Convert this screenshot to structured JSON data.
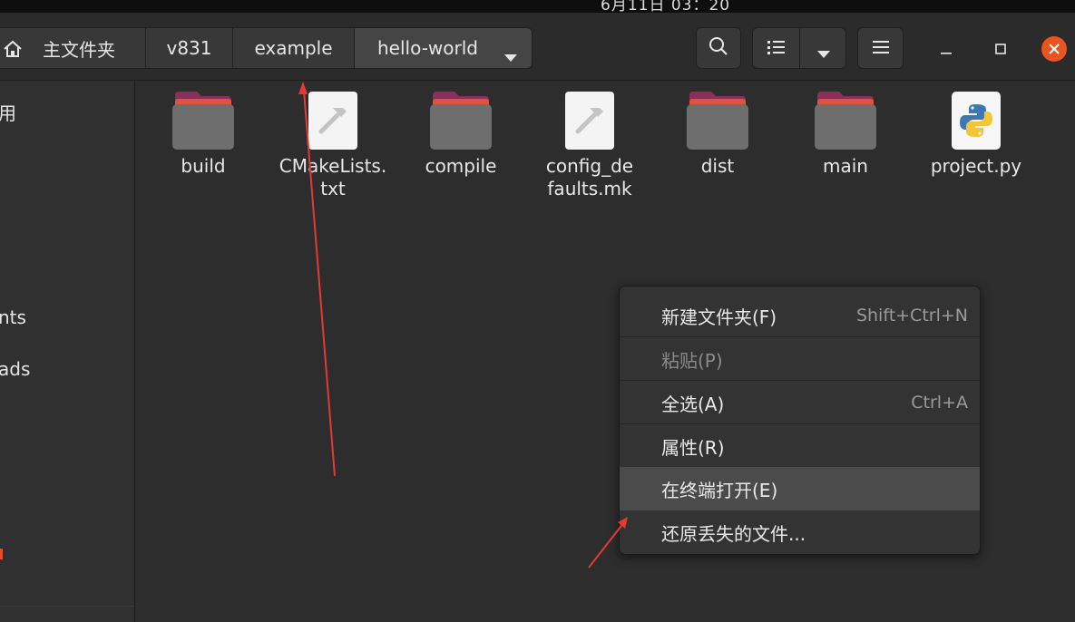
{
  "topbar": {
    "clock": "6月11日  03：20"
  },
  "header": {
    "home_icon": "home-icon",
    "breadcrumbs": [
      {
        "label": "主文件夹"
      },
      {
        "label": "v831"
      },
      {
        "label": "example"
      },
      {
        "label": "hello-world"
      }
    ],
    "crumb_menu_icon": "chevron-down-icon",
    "search_icon": "search-icon",
    "view_icon": "list-view-icon",
    "view_menu_icon": "chevron-down-icon",
    "menu_icon": "hamburger-icon",
    "window": {
      "minimize": "–",
      "maximize": "□",
      "close": "✕"
    },
    "accent_close": "#e95420"
  },
  "sidebar": {
    "items": [
      {
        "label": "用"
      },
      {
        "label": "nts"
      },
      {
        "label": "ads"
      }
    ]
  },
  "files": [
    {
      "name": "build",
      "kind": "folder"
    },
    {
      "name": "CMakeLists.txt",
      "kind": "text"
    },
    {
      "name": "compile",
      "kind": "folder"
    },
    {
      "name": "config_defaults.mk",
      "kind": "text"
    },
    {
      "name": "dist",
      "kind": "folder"
    },
    {
      "name": "main",
      "kind": "folder"
    },
    {
      "name": "project.py",
      "kind": "python"
    }
  ],
  "colors": {
    "folder_top": "#e0533d",
    "folder_tab": "#8c2d5b",
    "folder_body": "#6e6e6e",
    "arrow": "#e53935"
  },
  "context_menu": {
    "items": [
      {
        "label": "新建文件夹(F)",
        "shortcut": "Shift+Ctrl+N"
      },
      {
        "label": "粘贴(P)",
        "shortcut": ""
      },
      {
        "label": "全选(A)",
        "shortcut": "Ctrl+A"
      },
      {
        "label": "属性(R)",
        "shortcut": ""
      },
      {
        "label": "在终端打开(E)",
        "shortcut": ""
      },
      {
        "label": "还原丢失的文件...",
        "shortcut": ""
      }
    ]
  }
}
